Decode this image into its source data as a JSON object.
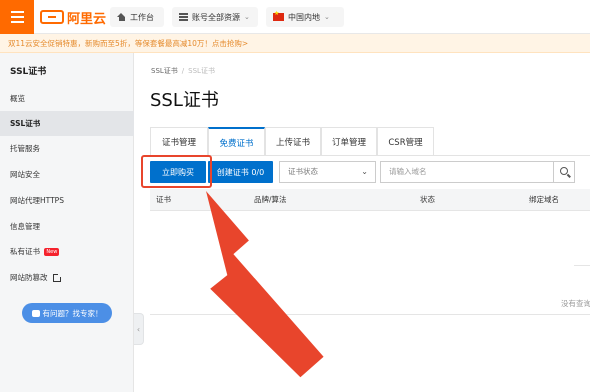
{
  "topbar": {
    "logo_text": "阿里云",
    "workbench": "工作台",
    "account": "账号全部资源",
    "region": "中国内地"
  },
  "notice": "双11云安全促销特惠，新购而至5折，等保套餐最高减10万！点击抢购>",
  "sidebar": {
    "title": "SSL证书",
    "items": [
      {
        "label": "概览"
      },
      {
        "label": "SSL证书"
      },
      {
        "label": "托管服务"
      },
      {
        "label": "网站安全"
      },
      {
        "label": "网站代理HTTPS"
      },
      {
        "label": "信息管理"
      },
      {
        "label": "私有证书"
      },
      {
        "label": "网站防篡改"
      }
    ],
    "new_badge": "New",
    "help_button": "有问题？找专家！"
  },
  "main": {
    "breadcrumb_root": "SSL证书",
    "breadcrumb_current": "SSL证书",
    "page_title": "SSL证书",
    "tabs": [
      {
        "label": "证书管理"
      },
      {
        "label": "免费证书"
      },
      {
        "label": "上传证书"
      },
      {
        "label": "订单管理"
      },
      {
        "label": "CSR管理"
      }
    ],
    "buy_button": "立即购买",
    "create_button": "创建证书 0/0",
    "status_select": "证书状态",
    "search_placeholder": "请输入域名",
    "columns": [
      "证书",
      "品牌/算法",
      "状态",
      "绑定域名"
    ],
    "empty_text": "没有查询"
  },
  "colors": {
    "brand": "#ff6a00",
    "primary": "#0070cc",
    "annotation": "#e8452c"
  }
}
